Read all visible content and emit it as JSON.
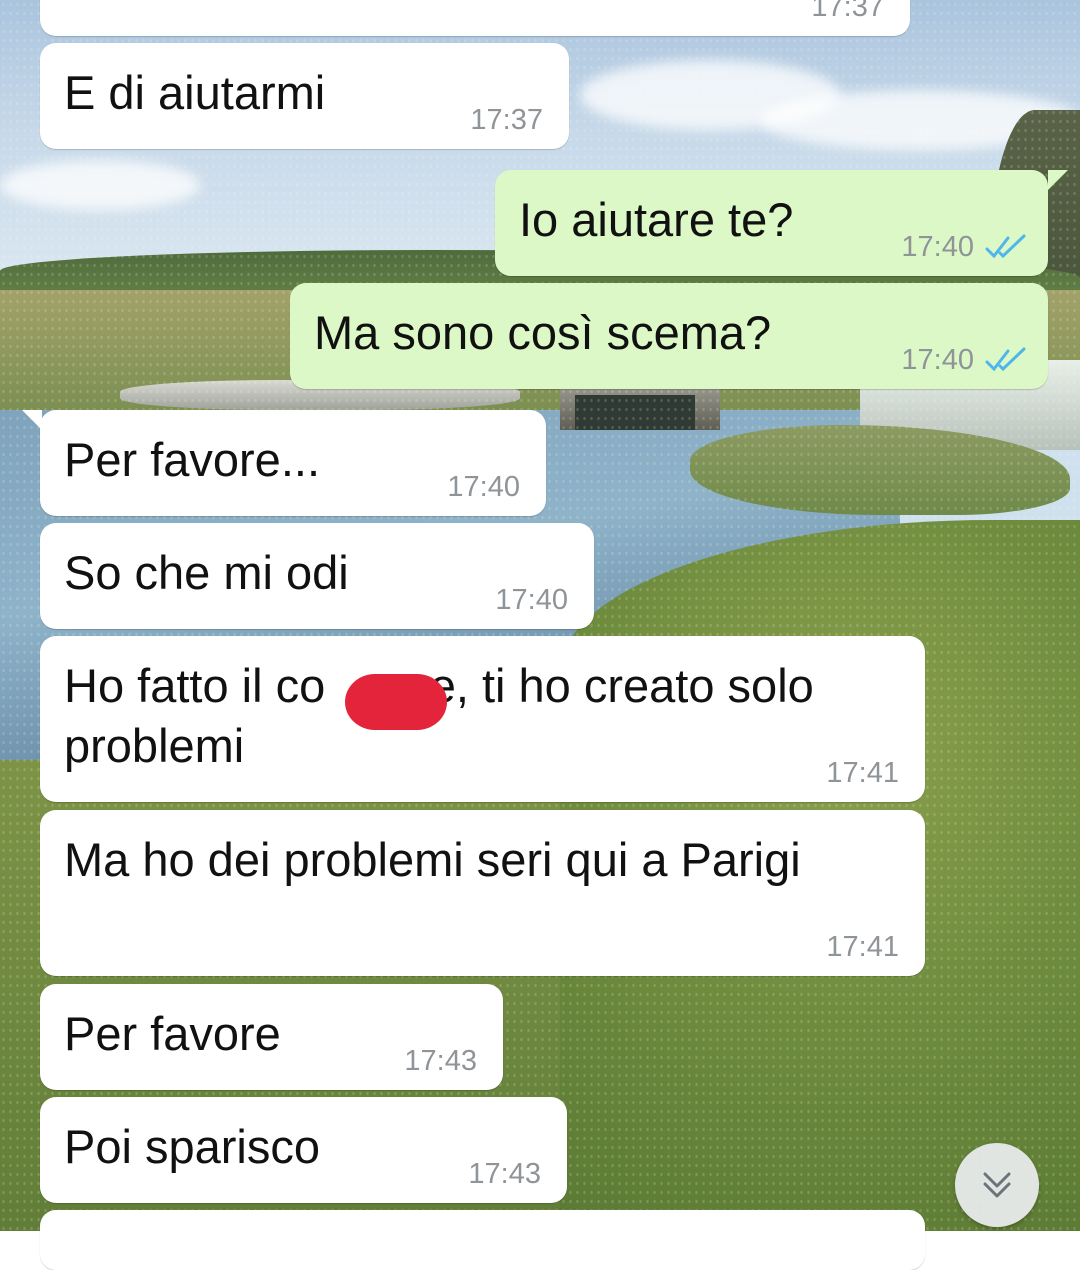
{
  "colors": {
    "incoming_bubble": "#ffffff",
    "outgoing_bubble": "#dcf8c6",
    "read_ticks": "#4fb6ec",
    "timestamp": "#8f9499",
    "redaction": "#e4243b"
  },
  "messages": [
    {
      "direction": "incoming",
      "text": "",
      "time": "17:37"
    },
    {
      "direction": "incoming",
      "text": "E di aiutarmi",
      "time": "17:37"
    },
    {
      "direction": "outgoing",
      "text": "Io aiutare te?",
      "time": "17:40",
      "status_icon": "double-check-read-icon"
    },
    {
      "direction": "outgoing",
      "text": "Ma sono così scema?",
      "time": "17:40",
      "status_icon": "double-check-read-icon"
    },
    {
      "direction": "incoming",
      "text": "Per favore...",
      "time": "17:40"
    },
    {
      "direction": "incoming",
      "text": "So che mi odi",
      "time": "17:40"
    },
    {
      "direction": "incoming",
      "text": "Ho fatto il co      ne, ti ho creato solo\nproblemi",
      "time": "17:41",
      "redacted": true
    },
    {
      "direction": "incoming",
      "text": "Ma ho dei problemi seri qui a Parigi",
      "time": "17:41"
    },
    {
      "direction": "incoming",
      "text": "Per favore",
      "time": "17:43"
    },
    {
      "direction": "incoming",
      "text": "Poi sparisco",
      "time": "17:43"
    },
    {
      "direction": "incoming",
      "text": "",
      "time": ""
    }
  ],
  "scroll_button": {
    "icon": "double-chevron-down-icon"
  }
}
